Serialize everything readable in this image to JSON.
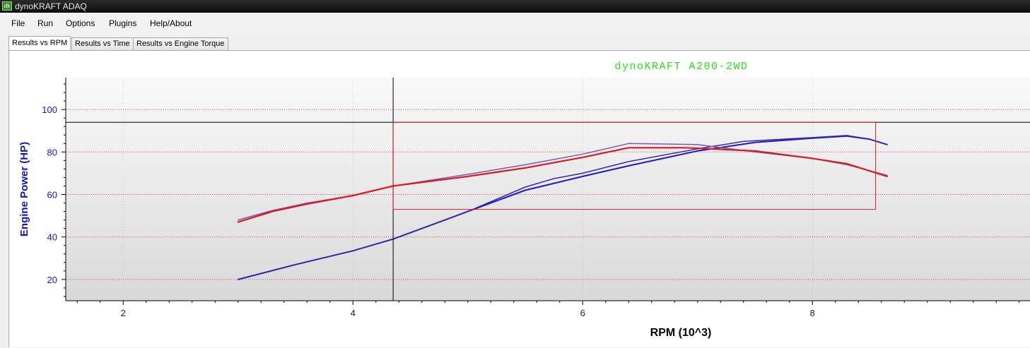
{
  "window": {
    "title": "dynoKRAFT ADAQ",
    "icon": "app-logo-icon"
  },
  "menu": [
    "File",
    "Run",
    "Options",
    "Plugins",
    "Help/About"
  ],
  "tabs": [
    {
      "label": "Results vs RPM",
      "active": true
    },
    {
      "label": "Results vs Time",
      "active": false
    },
    {
      "label": "Results vs Engine Torque",
      "active": false
    }
  ],
  "colors": {
    "title": "#22e01a",
    "yaxis": "#1515b5",
    "series_blue": "#1a1ad0",
    "series_red": "#d81b24",
    "selection": "#e02020",
    "grid": "#c83232"
  },
  "chart_data": {
    "type": "line",
    "title": "dynoKRAFT A200-2WD",
    "xlabel": "RPM (10^3)",
    "ylabel": "Engine Power (HP)",
    "xlim": [
      1.5,
      9.9
    ],
    "ylim": [
      10,
      115
    ],
    "xticks": [
      2,
      4,
      6,
      8
    ],
    "yticks": [
      20,
      40,
      60,
      80,
      100
    ],
    "grid": "dotted",
    "crosshair": {
      "x": 4.35,
      "y": 94
    },
    "selection_box": {
      "x0": 4.35,
      "x1": 8.55,
      "y0": 53,
      "y1": 94
    },
    "series": [
      {
        "color": "#1a1ad0",
        "width": 2,
        "x": [
          3.0,
          3.5,
          4.0,
          4.35,
          5.0,
          5.5,
          6.0,
          6.4,
          7.0,
          7.5,
          8.0,
          8.3,
          8.5,
          8.65
        ],
        "y": [
          20,
          27,
          33.5,
          39,
          52,
          62,
          68.5,
          73.5,
          80.5,
          84.5,
          86.5,
          87.5,
          86,
          83.5
        ]
      },
      {
        "color": "#3a2a9a",
        "width": 1.5,
        "x": [
          3.0,
          3.5,
          4.0,
          4.35,
          5.0,
          5.5,
          5.75,
          6.0,
          6.4,
          7.0,
          7.4,
          8.0,
          8.3,
          8.5,
          8.65
        ],
        "y": [
          20,
          27,
          33.5,
          39,
          52,
          63.5,
          67.5,
          70,
          75.5,
          81.5,
          85,
          86.8,
          87.8,
          86,
          83.5
        ]
      },
      {
        "color": "#7a5aa8",
        "width": 1.5,
        "x": [
          3.0,
          3.3,
          3.6,
          4.0,
          4.35,
          5.0,
          5.5,
          6.0,
          6.4,
          7.0,
          7.5,
          8.0,
          8.3,
          8.65
        ],
        "y": [
          48,
          52.5,
          56,
          59.5,
          64,
          69.5,
          74,
          79,
          84,
          83.5,
          80,
          77,
          74,
          69
        ]
      },
      {
        "color": "#d81b24",
        "width": 2.2,
        "x": [
          3.0,
          3.3,
          3.6,
          4.0,
          4.35,
          5.0,
          5.5,
          6.0,
          6.4,
          6.9,
          7.5,
          8.0,
          8.3,
          8.65
        ],
        "y": [
          47,
          52,
          55.5,
          59.5,
          64,
          68.5,
          72.5,
          77.5,
          82,
          82,
          80.5,
          77,
          74.5,
          68.5
        ]
      }
    ]
  }
}
